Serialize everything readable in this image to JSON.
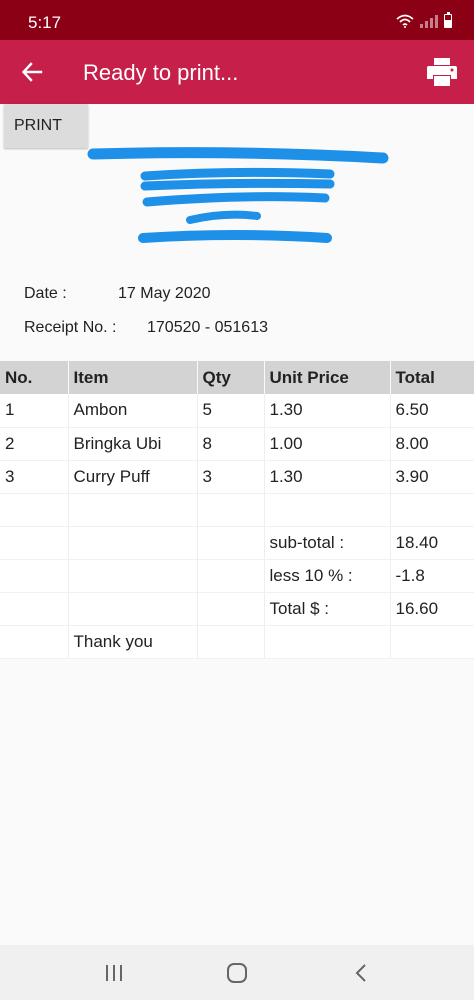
{
  "status_bar": {
    "time": "5:17",
    "icons": [
      "wifi-icon",
      "signal-icon",
      "battery-icon"
    ]
  },
  "app_bar": {
    "title": "Ready to print...",
    "back_icon": "arrow-left-icon",
    "action_icon": "printer-icon",
    "color": "#c51f4a"
  },
  "print_button": {
    "label": "PRINT"
  },
  "receipt": {
    "date_label": "Date :",
    "date_value": "17 May 2020",
    "receipt_label": "Receipt No. :",
    "receipt_value": "170520 - 051613",
    "columns": [
      "No.",
      "Item",
      "Qty",
      "Unit Price",
      "Total"
    ],
    "rows": [
      [
        "1",
        "Ambon",
        "5",
        "1.30",
        "6.50"
      ],
      [
        "2",
        "Bringka Ubi",
        "8",
        "1.00",
        "8.00"
      ],
      [
        "3",
        "Curry Puff",
        "3",
        "1.30",
        "3.90"
      ],
      [
        "",
        "",
        "",
        "",
        ""
      ],
      [
        "",
        "",
        "",
        "sub-total :",
        "18.40"
      ],
      [
        "",
        "",
        "",
        "less 10 % :",
        "-1.8"
      ],
      [
        "",
        "",
        "",
        "Total $ :",
        "16.60"
      ],
      [
        "",
        "Thank you",
        "",
        "",
        ""
      ]
    ]
  },
  "nav_bar": {
    "icons": [
      "recent-apps-icon",
      "home-icon",
      "back-icon"
    ]
  }
}
